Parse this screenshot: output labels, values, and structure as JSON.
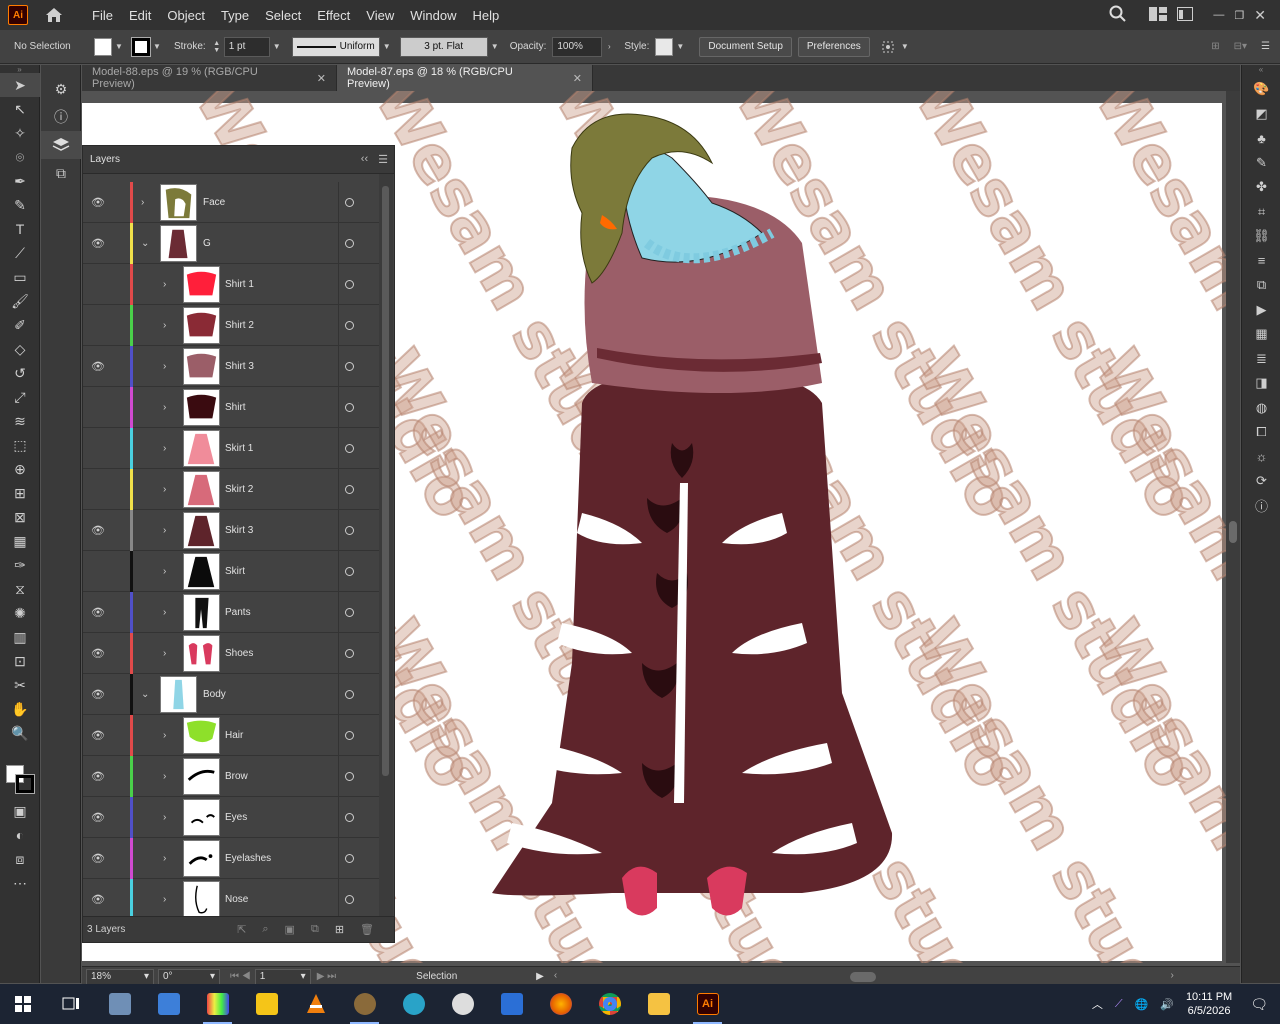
{
  "app": {
    "logo_text": "Ai",
    "menus": [
      "File",
      "Edit",
      "Object",
      "Type",
      "Select",
      "Effect",
      "View",
      "Window",
      "Help"
    ]
  },
  "control_bar": {
    "selection_label": "No Selection",
    "stroke_label": "Stroke:",
    "stroke_value": "1 pt",
    "stroke_profile": "Uniform",
    "brush_value": "3 pt. Flat",
    "opacity_label": "Opacity:",
    "opacity_value": "100%",
    "style_label": "Style:",
    "document_setup_label": "Document Setup",
    "preferences_label": "Preferences"
  },
  "tabs": [
    {
      "label": "Model-88.eps @ 19 % (RGB/CPU Preview)",
      "active": false
    },
    {
      "label": "Model-87.eps @ 18 % (RGB/CPU Preview)",
      "active": true
    }
  ],
  "layers_panel": {
    "title": "Layers",
    "footer_count": "3 Layers",
    "rows": [
      {
        "name": "Face",
        "visible": true,
        "indent": 0,
        "expanded": false,
        "color": "#e04a4a",
        "thumb": "face"
      },
      {
        "name": "G",
        "visible": true,
        "indent": 0,
        "expanded": true,
        "color": "#f0e04a",
        "thumb": "dress"
      },
      {
        "name": "Shirt 1",
        "visible": false,
        "indent": 1,
        "expanded": false,
        "color": "#e04a4a",
        "thumb": "red"
      },
      {
        "name": "Shirt 2",
        "visible": false,
        "indent": 1,
        "expanded": false,
        "color": "#4ad04a",
        "thumb": "maroon"
      },
      {
        "name": "Shirt 3",
        "visible": true,
        "indent": 1,
        "expanded": false,
        "color": "#5050c8",
        "thumb": "mauve"
      },
      {
        "name": "Shirt",
        "visible": false,
        "indent": 1,
        "expanded": false,
        "color": "#d04ad0",
        "thumb": "dark"
      },
      {
        "name": "Skirt 1",
        "visible": false,
        "indent": 1,
        "expanded": false,
        "color": "#4ad0e0",
        "thumb": "pink"
      },
      {
        "name": "Skirt 2",
        "visible": false,
        "indent": 1,
        "expanded": false,
        "color": "#f0e04a",
        "thumb": "pinkdark"
      },
      {
        "name": "Skirt 3",
        "visible": true,
        "indent": 1,
        "expanded": false,
        "color": "#888888",
        "thumb": "maroonskirt"
      },
      {
        "name": "Skirt",
        "visible": false,
        "indent": 1,
        "expanded": false,
        "color": "#111111",
        "thumb": "black"
      },
      {
        "name": "Pants",
        "visible": true,
        "indent": 1,
        "expanded": false,
        "color": "#5050c8",
        "thumb": "pants"
      },
      {
        "name": "Shoes",
        "visible": true,
        "indent": 1,
        "expanded": false,
        "color": "#e04a4a",
        "thumb": "shoes"
      },
      {
        "name": "Body",
        "visible": true,
        "indent": 0,
        "expanded": true,
        "color": "#111111",
        "thumb": "body"
      },
      {
        "name": "Hair",
        "visible": true,
        "indent": 1,
        "expanded": false,
        "color": "#e04a4a",
        "thumb": "hair"
      },
      {
        "name": "Brow",
        "visible": true,
        "indent": 1,
        "expanded": false,
        "color": "#4ad04a",
        "thumb": "brow"
      },
      {
        "name": "Eyes",
        "visible": true,
        "indent": 1,
        "expanded": false,
        "color": "#5050c8",
        "thumb": "eyes"
      },
      {
        "name": "Eyelashes",
        "visible": true,
        "indent": 1,
        "expanded": false,
        "color": "#d04ad0",
        "thumb": "lashes"
      },
      {
        "name": "Nose",
        "visible": true,
        "indent": 1,
        "expanded": false,
        "color": "#4ad0e0",
        "thumb": "nose"
      }
    ]
  },
  "status_bar": {
    "zoom": "18%",
    "rotation": "0°",
    "artboard": "1",
    "tool_label": "Selection"
  },
  "watermark_text": "Wesam studio",
  "taskbar": {
    "time": "10:11 PM",
    "date": "6/5/2026"
  }
}
